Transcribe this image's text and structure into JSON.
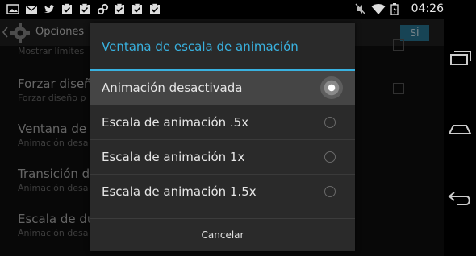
{
  "status_bar": {
    "time": "04:26",
    "left_icons": [
      "image-icon",
      "mail-icon",
      "twitter-icon",
      "clipboard-check-icon",
      "clipboard-check-icon",
      "link-icon",
      "clipboard-check-icon",
      "clipboard-check-icon",
      "clipboard-check-icon",
      "clipboard-check-icon",
      "clipboard-check-icon"
    ],
    "right_icons": [
      "mute-icon",
      "wifi-icon",
      "battery-icon"
    ]
  },
  "app_bar": {
    "title": "Opciones",
    "switch_label": "SÍ"
  },
  "background_list": [
    {
      "title": "",
      "subtitle": "Mostrar límites"
    },
    {
      "title": "Forzar diseñ",
      "subtitle": "Forzar diseño p"
    },
    {
      "title": "Ventana de",
      "subtitle": "Animación desa"
    },
    {
      "title": "Transición d",
      "subtitle": "Animación desa"
    },
    {
      "title": "Escala de du",
      "subtitle": "Animación desa"
    }
  ],
  "dialog": {
    "title": "Ventana de escala de animación",
    "options": [
      {
        "label": "Animación desactivada",
        "selected": true
      },
      {
        "label": "Escala de animación .5x",
        "selected": false
      },
      {
        "label": "Escala de animación 1x",
        "selected": false
      },
      {
        "label": "Escala de animación 1.5x",
        "selected": false
      }
    ],
    "cancel_label": "Cancelar"
  },
  "colors": {
    "accent": "#39b2e0",
    "dialog_bg": "#2a2a2a",
    "selected_row": "#454545"
  }
}
